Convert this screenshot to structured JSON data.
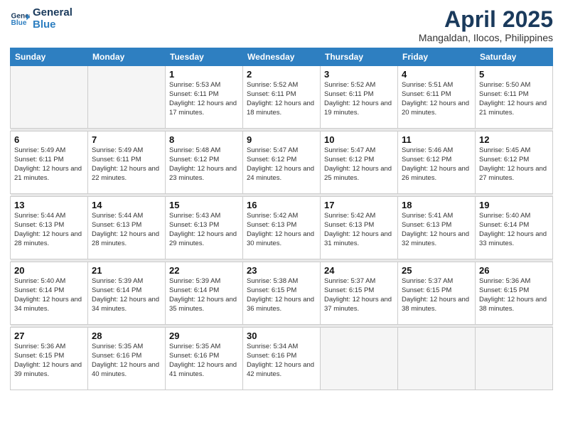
{
  "logo": {
    "text_general": "General",
    "text_blue": "Blue"
  },
  "title": "April 2025",
  "subtitle": "Mangaldan, Ilocos, Philippines",
  "days_of_week": [
    "Sunday",
    "Monday",
    "Tuesday",
    "Wednesday",
    "Thursday",
    "Friday",
    "Saturday"
  ],
  "weeks": [
    [
      {
        "day": "",
        "info": ""
      },
      {
        "day": "",
        "info": ""
      },
      {
        "day": "1",
        "info": "Sunrise: 5:53 AM\nSunset: 6:11 PM\nDaylight: 12 hours and 17 minutes."
      },
      {
        "day": "2",
        "info": "Sunrise: 5:52 AM\nSunset: 6:11 PM\nDaylight: 12 hours and 18 minutes."
      },
      {
        "day": "3",
        "info": "Sunrise: 5:52 AM\nSunset: 6:11 PM\nDaylight: 12 hours and 19 minutes."
      },
      {
        "day": "4",
        "info": "Sunrise: 5:51 AM\nSunset: 6:11 PM\nDaylight: 12 hours and 20 minutes."
      },
      {
        "day": "5",
        "info": "Sunrise: 5:50 AM\nSunset: 6:11 PM\nDaylight: 12 hours and 21 minutes."
      }
    ],
    [
      {
        "day": "6",
        "info": "Sunrise: 5:49 AM\nSunset: 6:11 PM\nDaylight: 12 hours and 21 minutes."
      },
      {
        "day": "7",
        "info": "Sunrise: 5:49 AM\nSunset: 6:11 PM\nDaylight: 12 hours and 22 minutes."
      },
      {
        "day": "8",
        "info": "Sunrise: 5:48 AM\nSunset: 6:12 PM\nDaylight: 12 hours and 23 minutes."
      },
      {
        "day": "9",
        "info": "Sunrise: 5:47 AM\nSunset: 6:12 PM\nDaylight: 12 hours and 24 minutes."
      },
      {
        "day": "10",
        "info": "Sunrise: 5:47 AM\nSunset: 6:12 PM\nDaylight: 12 hours and 25 minutes."
      },
      {
        "day": "11",
        "info": "Sunrise: 5:46 AM\nSunset: 6:12 PM\nDaylight: 12 hours and 26 minutes."
      },
      {
        "day": "12",
        "info": "Sunrise: 5:45 AM\nSunset: 6:12 PM\nDaylight: 12 hours and 27 minutes."
      }
    ],
    [
      {
        "day": "13",
        "info": "Sunrise: 5:44 AM\nSunset: 6:13 PM\nDaylight: 12 hours and 28 minutes."
      },
      {
        "day": "14",
        "info": "Sunrise: 5:44 AM\nSunset: 6:13 PM\nDaylight: 12 hours and 28 minutes."
      },
      {
        "day": "15",
        "info": "Sunrise: 5:43 AM\nSunset: 6:13 PM\nDaylight: 12 hours and 29 minutes."
      },
      {
        "day": "16",
        "info": "Sunrise: 5:42 AM\nSunset: 6:13 PM\nDaylight: 12 hours and 30 minutes."
      },
      {
        "day": "17",
        "info": "Sunrise: 5:42 AM\nSunset: 6:13 PM\nDaylight: 12 hours and 31 minutes."
      },
      {
        "day": "18",
        "info": "Sunrise: 5:41 AM\nSunset: 6:13 PM\nDaylight: 12 hours and 32 minutes."
      },
      {
        "day": "19",
        "info": "Sunrise: 5:40 AM\nSunset: 6:14 PM\nDaylight: 12 hours and 33 minutes."
      }
    ],
    [
      {
        "day": "20",
        "info": "Sunrise: 5:40 AM\nSunset: 6:14 PM\nDaylight: 12 hours and 34 minutes."
      },
      {
        "day": "21",
        "info": "Sunrise: 5:39 AM\nSunset: 6:14 PM\nDaylight: 12 hours and 34 minutes."
      },
      {
        "day": "22",
        "info": "Sunrise: 5:39 AM\nSunset: 6:14 PM\nDaylight: 12 hours and 35 minutes."
      },
      {
        "day": "23",
        "info": "Sunrise: 5:38 AM\nSunset: 6:15 PM\nDaylight: 12 hours and 36 minutes."
      },
      {
        "day": "24",
        "info": "Sunrise: 5:37 AM\nSunset: 6:15 PM\nDaylight: 12 hours and 37 minutes."
      },
      {
        "day": "25",
        "info": "Sunrise: 5:37 AM\nSunset: 6:15 PM\nDaylight: 12 hours and 38 minutes."
      },
      {
        "day": "26",
        "info": "Sunrise: 5:36 AM\nSunset: 6:15 PM\nDaylight: 12 hours and 38 minutes."
      }
    ],
    [
      {
        "day": "27",
        "info": "Sunrise: 5:36 AM\nSunset: 6:15 PM\nDaylight: 12 hours and 39 minutes."
      },
      {
        "day": "28",
        "info": "Sunrise: 5:35 AM\nSunset: 6:16 PM\nDaylight: 12 hours and 40 minutes."
      },
      {
        "day": "29",
        "info": "Sunrise: 5:35 AM\nSunset: 6:16 PM\nDaylight: 12 hours and 41 minutes."
      },
      {
        "day": "30",
        "info": "Sunrise: 5:34 AM\nSunset: 6:16 PM\nDaylight: 12 hours and 42 minutes."
      },
      {
        "day": "",
        "info": ""
      },
      {
        "day": "",
        "info": ""
      },
      {
        "day": "",
        "info": ""
      }
    ]
  ]
}
